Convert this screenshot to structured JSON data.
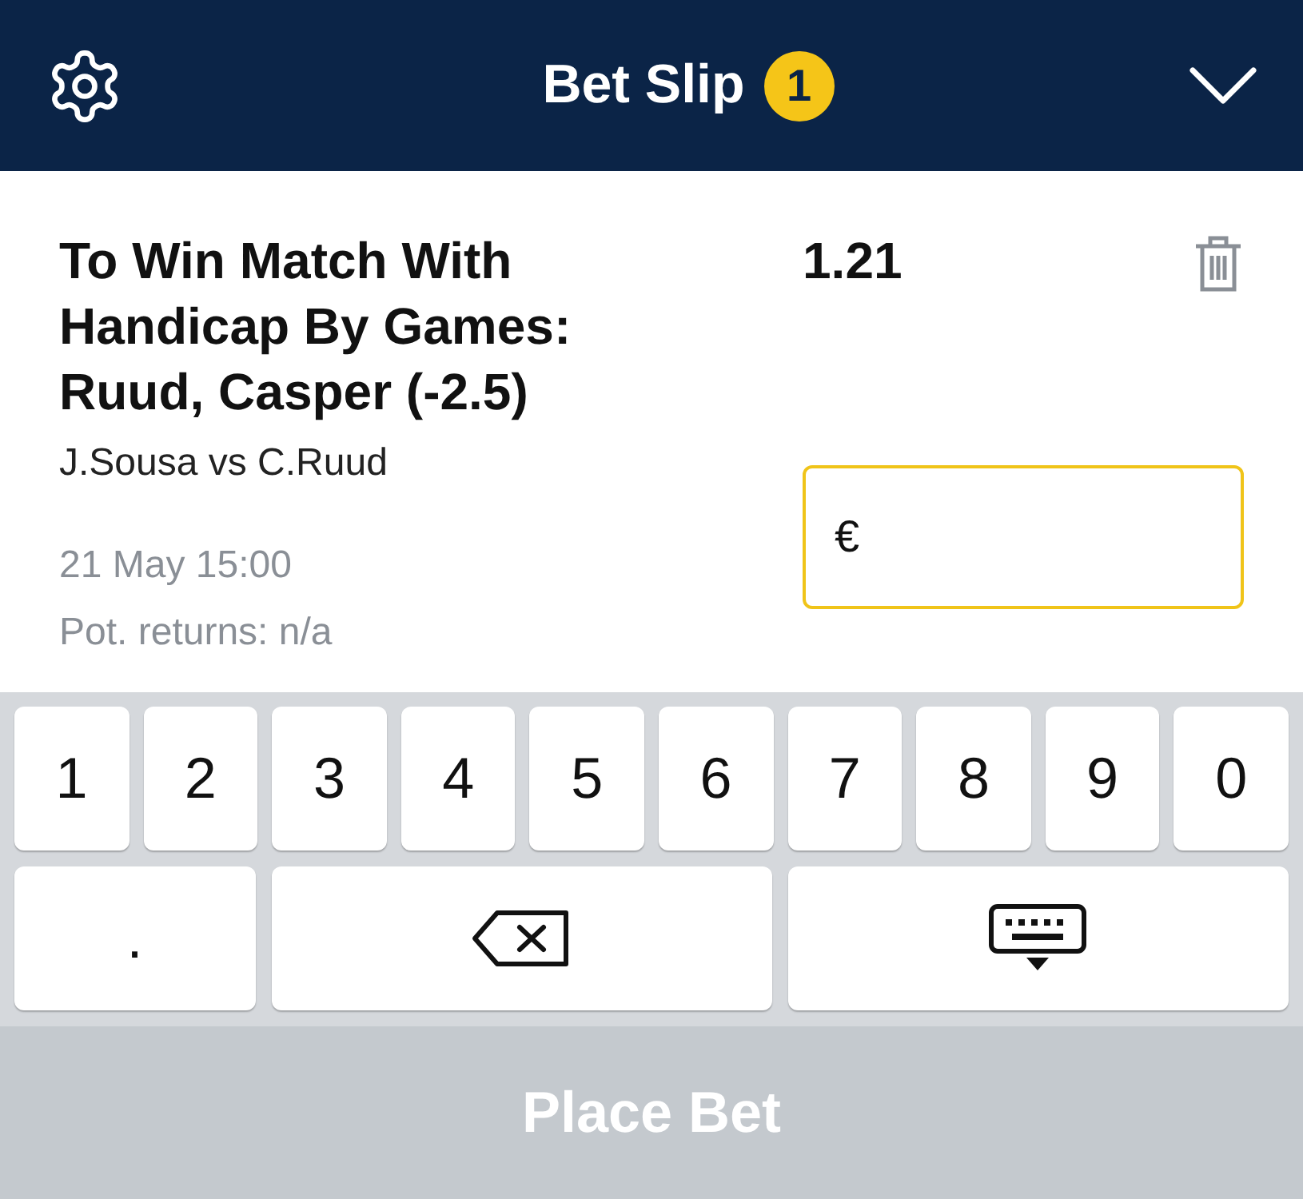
{
  "header": {
    "title": "Bet Slip",
    "count": "1"
  },
  "bet": {
    "market": "To Win Match With Handicap By Games: Ruud, Casper (-2.5)",
    "odds": "1.21",
    "event": "J.Sousa vs C.Ruud",
    "date": "21 May 15:00",
    "returns": "Pot. returns: n/a",
    "currency": "€"
  },
  "keyboard": {
    "rows": [
      [
        {
          "kind": "char",
          "label": "1"
        },
        {
          "kind": "char",
          "label": "2"
        },
        {
          "kind": "char",
          "label": "3"
        },
        {
          "kind": "char",
          "label": "4"
        },
        {
          "kind": "char",
          "label": "5"
        },
        {
          "kind": "char",
          "label": "6"
        },
        {
          "kind": "char",
          "label": "7"
        },
        {
          "kind": "char",
          "label": "8"
        },
        {
          "kind": "char",
          "label": "9"
        },
        {
          "kind": "char",
          "label": "0"
        }
      ],
      [
        {
          "kind": "char",
          "label": "."
        },
        {
          "kind": "backspace"
        },
        {
          "kind": "hide"
        }
      ]
    ]
  },
  "place_bet": {
    "label": "Place Bet",
    "disabled": true
  }
}
